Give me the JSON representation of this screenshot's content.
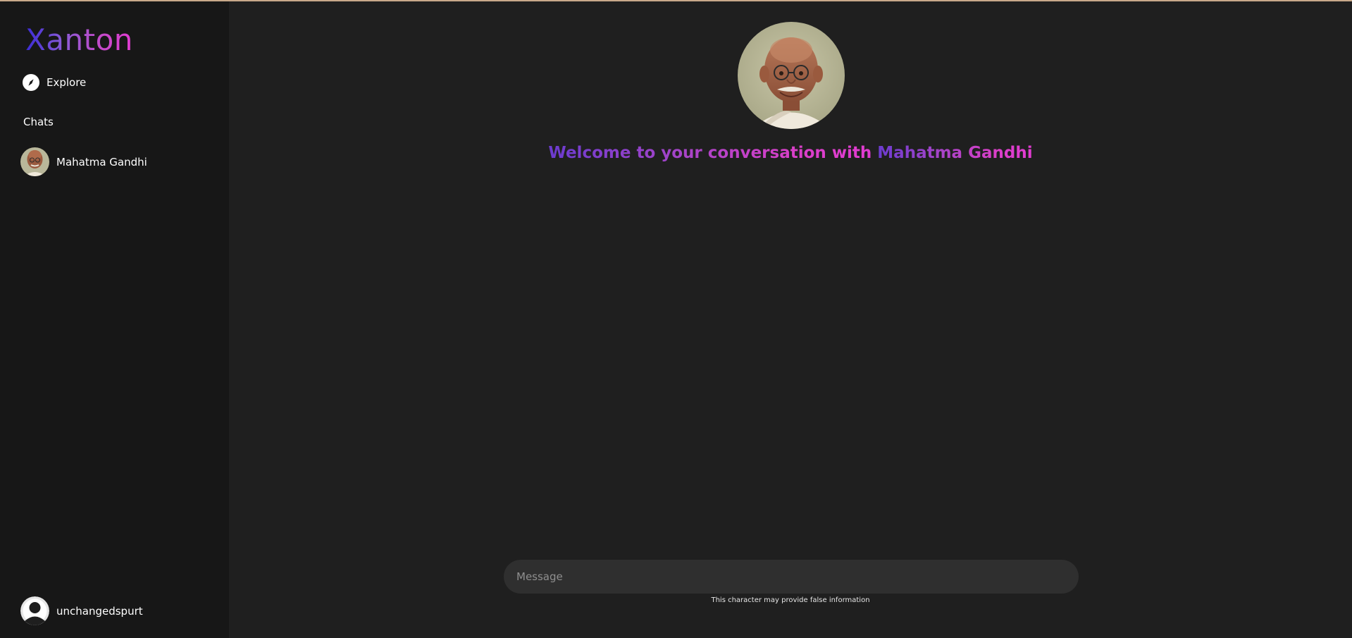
{
  "app": {
    "logo": "Xanton"
  },
  "sidebar": {
    "explore_label": "Explore",
    "chats_heading": "Chats",
    "chats": [
      {
        "name": "Mahatma Gandhi"
      }
    ],
    "user": {
      "username": "unchangedspurt"
    }
  },
  "main": {
    "welcome_prefix": "Welcome to your conversation with ",
    "welcome_name": "Mahatma Gandhi",
    "message_placeholder": "Message",
    "disclaimer": "This character may provide false information"
  },
  "colors": {
    "sidebar_bg": "#171717",
    "main_bg": "#1f1f1f",
    "input_bg": "#2f2f2f",
    "accent_gradient_start": "#3b2bd6",
    "accent_gradient_end": "#e23bd2"
  },
  "icons": {
    "explore": "compass-icon",
    "user": "user-avatar-icon"
  }
}
